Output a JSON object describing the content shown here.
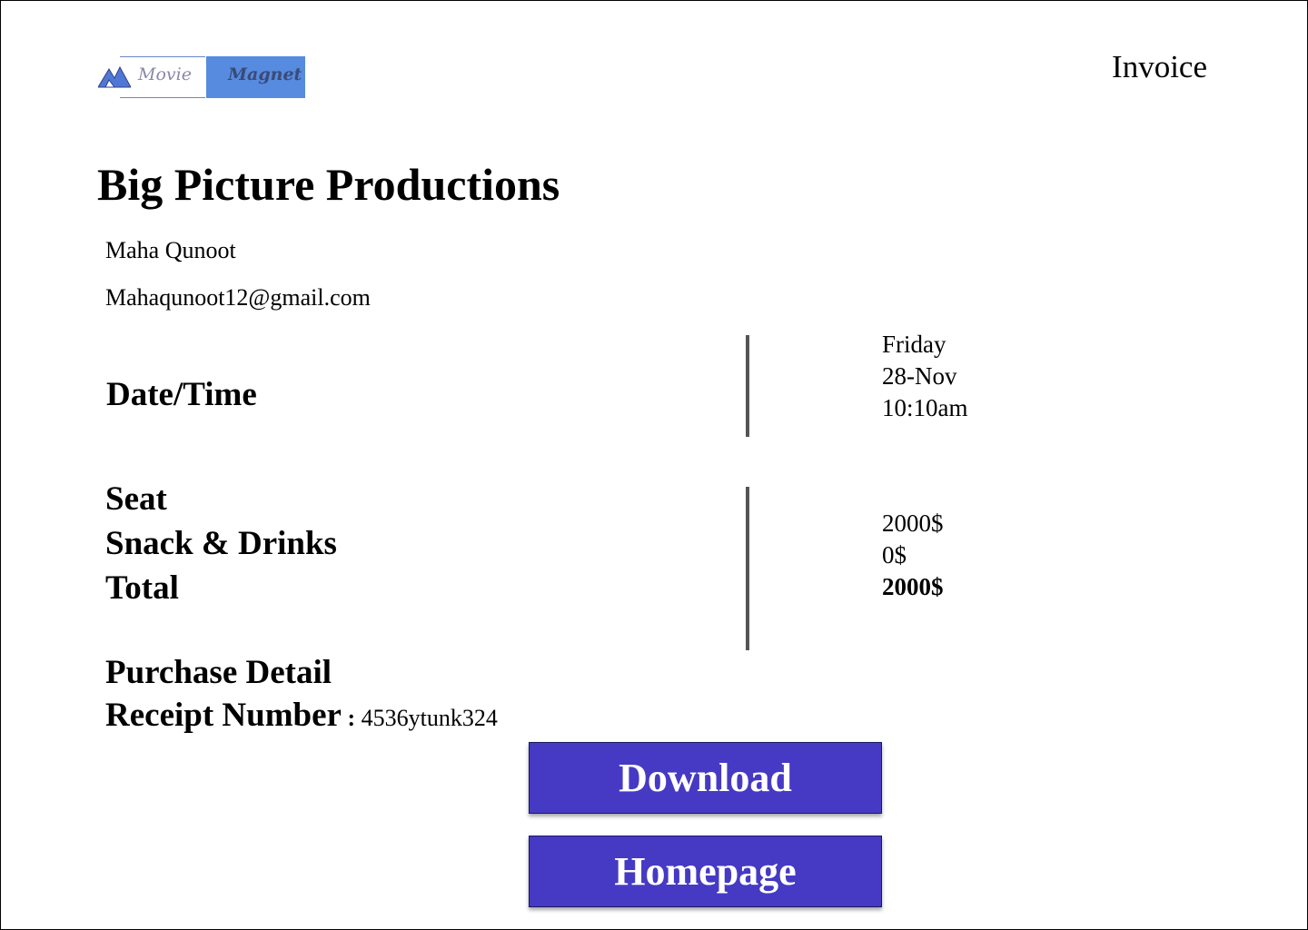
{
  "brand": {
    "word1": "Movie",
    "word2": "Magnet",
    "icon": "mountain-icon",
    "colors": {
      "accent": "#568bdf",
      "button": "#463ac4"
    }
  },
  "header": {
    "title": "Invoice"
  },
  "company": "Big Picture Productions",
  "customer": {
    "name": "Maha Qunoot",
    "email": "Mahaqunoot12@gmail.com"
  },
  "datetime": {
    "label": "Date/Time",
    "day": "Friday",
    "date": "28-Nov",
    "time": "10:10am"
  },
  "charges": {
    "seat_label": "Seat",
    "snack_label": "Snack & Drinks",
    "total_label": "Total",
    "seat_value": "2000$",
    "snack_value": "0$",
    "total_value": "2000$"
  },
  "purchase": {
    "heading": "Purchase Detail",
    "receipt_label": "Receipt Number",
    "receipt_sep": " : ",
    "receipt_value": "4536ytunk324"
  },
  "actions": {
    "download": "Download",
    "homepage": "Homepage"
  }
}
